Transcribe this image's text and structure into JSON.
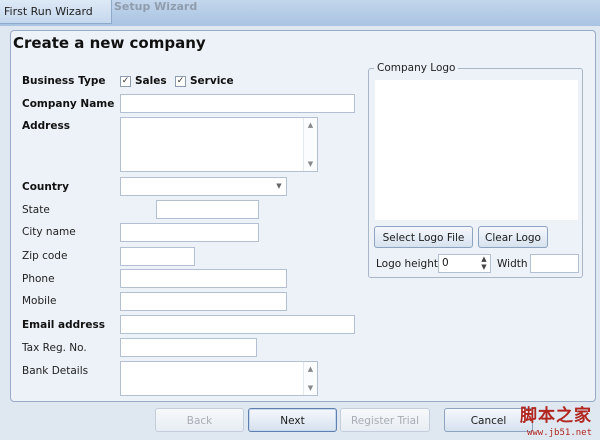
{
  "window": {
    "tab_title": "First Run Wizard",
    "background_title": "Setup Wizard"
  },
  "page": {
    "title": "Create a new company"
  },
  "form": {
    "business_type": {
      "label": "Business Type",
      "options": [
        {
          "label": "Sales",
          "checked": true
        },
        {
          "label": "Service",
          "checked": true
        }
      ]
    },
    "company_name": {
      "label": "Company Name",
      "value": ""
    },
    "address": {
      "label": "Address",
      "value": ""
    },
    "country": {
      "label": "Country",
      "value": ""
    },
    "state": {
      "label": "State",
      "value": ""
    },
    "city": {
      "label": "City name",
      "value": ""
    },
    "zip": {
      "label": "Zip code",
      "value": ""
    },
    "phone": {
      "label": "Phone",
      "value": ""
    },
    "mobile": {
      "label": "Mobile",
      "value": ""
    },
    "email": {
      "label": "Email address",
      "value": ""
    },
    "tax": {
      "label": "Tax Reg. No.",
      "value": ""
    },
    "bank": {
      "label": "Bank Details",
      "value": ""
    }
  },
  "logo": {
    "group_title": "Company Logo",
    "select_button": "Select Logo File",
    "clear_button": "Clear Logo",
    "height_label": "Logo height",
    "height_value": "0",
    "width_label": "Width",
    "width_value": ""
  },
  "footer": {
    "back": "Back",
    "next": "Next",
    "register": "Register Trial",
    "cancel": "Cancel"
  },
  "watermark": {
    "text": "脚本之家",
    "url": "www.jb51.net"
  },
  "colors": {
    "accent": "#5f7fae",
    "watermark": "#b1261f"
  }
}
